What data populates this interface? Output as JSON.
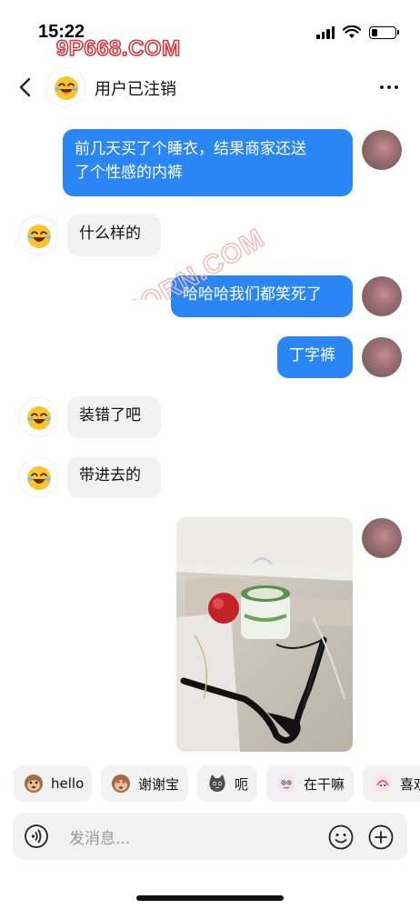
{
  "status_bar": {
    "time": "15:22",
    "watermark": "9P668.COM"
  },
  "header": {
    "title": "用户已注销",
    "back_icon": "chevron-left-icon",
    "more_icon": "more-dots-icon"
  },
  "messages": [
    {
      "side": "out",
      "text_lines": [
        "前几天买了个睡衣，结果商家还送",
        "了个性感的内裤"
      ]
    },
    {
      "side": "in",
      "text": "什么样的"
    },
    {
      "side": "out",
      "text": "哈哈哈我们都笑死了"
    },
    {
      "side": "out",
      "text": "丁字裤"
    },
    {
      "side": "in",
      "text": "装错了吧"
    },
    {
      "side": "in",
      "text": "带进去的"
    },
    {
      "side": "out",
      "type": "image",
      "content": "photo"
    }
  ],
  "diagonal_watermark": "91PORN.COM",
  "quick_replies": [
    {
      "label": "hello",
      "icon": "monkey-icon"
    },
    {
      "label": "谢谢宝",
      "icon": "monkey-heart-icon"
    },
    {
      "label": "呃",
      "icon": "cat-icon"
    },
    {
      "label": "在干嘛",
      "icon": "sticker-face-icon"
    },
    {
      "label": "喜欢",
      "icon": "sticker-pink-icon"
    }
  ],
  "input": {
    "placeholder": "发消息..."
  },
  "colors": {
    "outgoing_bubble": "#2b86f5",
    "incoming_bubble": "#f2f2f2",
    "accent": "#2b86f5"
  }
}
